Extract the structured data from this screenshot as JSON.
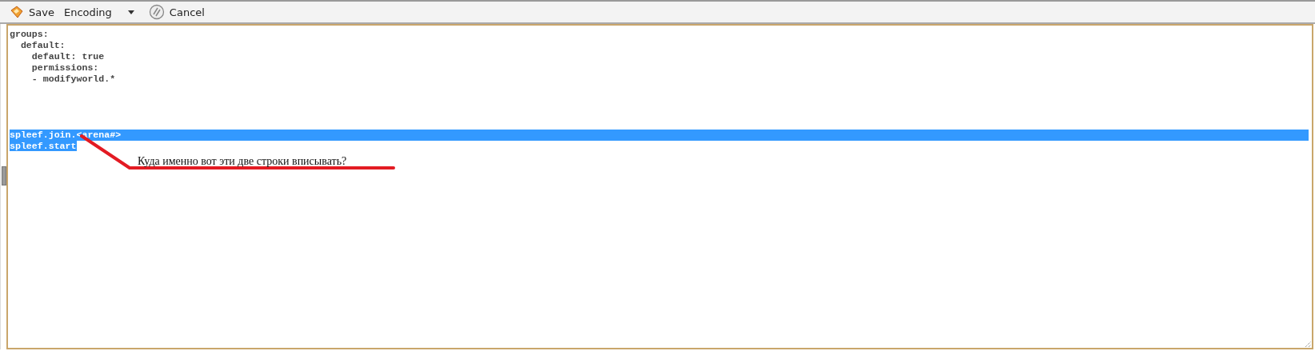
{
  "toolbar": {
    "buttons": [
      {
        "label": "Save",
        "kind": "save"
      },
      {
        "label": "Encoding",
        "kind": "dropdown"
      },
      {
        "label": "Cancel",
        "kind": "cancel"
      }
    ]
  },
  "editor": {
    "lines": [
      {
        "kind": "code",
        "text": "groups:",
        "selected": false,
        "line_break_selected": false
      },
      {
        "kind": "code",
        "text": "  default:",
        "selected": false,
        "line_break_selected": false
      },
      {
        "kind": "code",
        "text": "    default: true",
        "selected": false,
        "line_break_selected": false
      },
      {
        "kind": "code",
        "text": "    permissions:",
        "selected": false,
        "line_break_selected": false
      },
      {
        "kind": "code",
        "text": "    - modifyworld.*",
        "selected": false,
        "line_break_selected": false
      },
      {
        "kind": "blank"
      },
      {
        "kind": "blank"
      },
      {
        "kind": "blank"
      },
      {
        "kind": "blank"
      },
      {
        "kind": "code",
        "text": "spleef.join.<arena#>",
        "selected": true,
        "line_break_selected": true
      },
      {
        "kind": "code",
        "text": "spleef.start",
        "selected": true,
        "line_break_selected": false
      }
    ]
  },
  "annotation": {
    "text": "Куда именно вот эти две строки вписывать?"
  }
}
